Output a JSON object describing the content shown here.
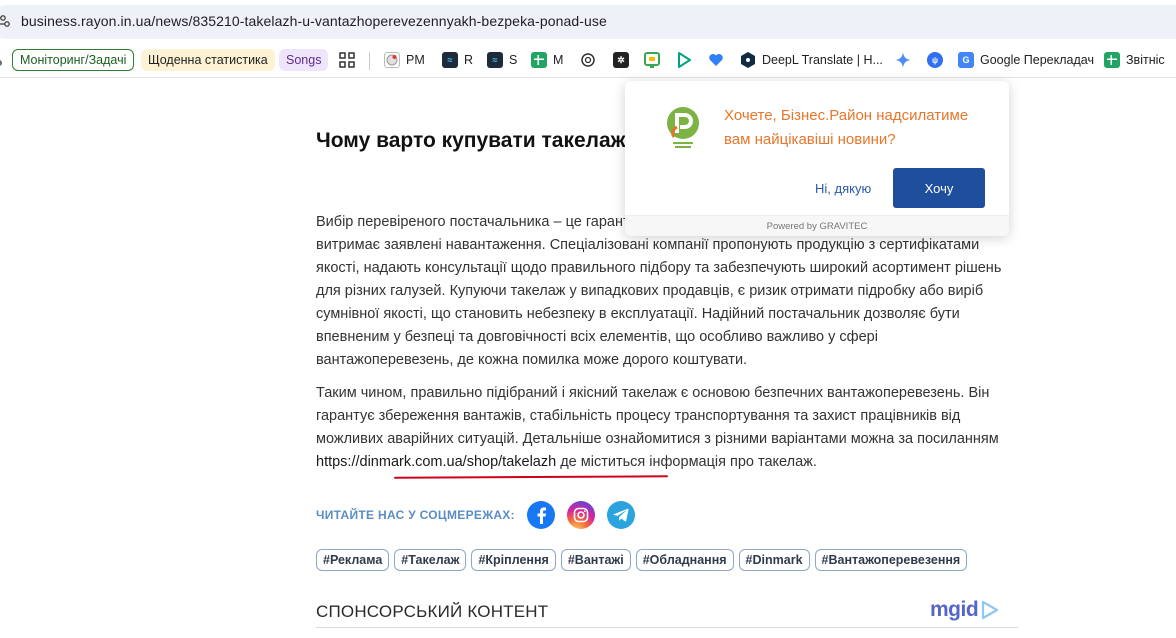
{
  "browser": {
    "url": "business.rayon.in.ua/news/835210-takelazh-u-vantazhoperevezennyakh-bezpeka-ponad-use",
    "bookmarks": [
      {
        "label": "Моніторинг/Задачі",
        "style": "chip-green"
      },
      {
        "label": "Щоденна статистика",
        "style": "chip-yellow"
      },
      {
        "label": "Songs",
        "style": "chip-purple"
      },
      {
        "label": "",
        "icon": "apps-grid-icon"
      },
      {
        "label": "PM",
        "icon": "pm-icon"
      },
      {
        "label": "R",
        "icon": "r-icon"
      },
      {
        "label": "S",
        "icon": "s-icon"
      },
      {
        "label": "M",
        "icon": "sheets-icon"
      },
      {
        "label": "",
        "icon": "openai-icon"
      },
      {
        "label": "",
        "icon": "pattern-icon"
      },
      {
        "label": "",
        "icon": "green-square-icon"
      },
      {
        "label": "",
        "icon": "play-icon"
      },
      {
        "label": "",
        "icon": "heart-icon"
      },
      {
        "label": "DeepL Translate | H...",
        "icon": "deepl-icon"
      },
      {
        "label": "",
        "icon": "gemini-icon"
      },
      {
        "label": "",
        "icon": "blue-circle-icon"
      },
      {
        "label": "Google Перекладач",
        "icon": "google-translate-icon"
      },
      {
        "label": "Звітніс",
        "icon": "sheets-icon"
      }
    ]
  },
  "article": {
    "heading": "Чому варто купувати такелаж у перевірених постачальників",
    "paragraph1": "Вибір перевіреного постачальника – це гарантія якості, безпеки та впевненості, що обладнання витримає заявлені навантаження. Спеціалізовані компанії пропонують продукцію з сертифікатами якості, надають консультації щодо правильного підбору та забезпечують широкий асортимент рішень для різних галузей. Купуючи такелаж у випадкових продавців, є ризик отримати підробку або виріб сумнівної якості, що становить небезпеку в експлуатації. Надійний постачальник дозволяє бути впевненим у безпеці та довговічності всіх елементів, що особливо важливо у сфері вантажоперевезень, де кожна помилка може дорого коштувати.",
    "paragraph2_before": "Таким чином, правильно підібраний і якісний такелаж є основою безпечних вантажоперевезень. Він гарантує збереження вантажів, стабільність процесу транспортування та захист працівників від можливих аварійних ситуацій. Детальніше ознайомитися з різними варіантами можна за посиланням ",
    "paragraph2_link": "https://dinmark.com.ua/shop/takelazh",
    "paragraph2_after": " де міститься інформація про такелаж.",
    "social_label": "ЧИТАЙТЕ НАС У СОЦМЕРЕЖАХ:",
    "tags": [
      "#Реклама",
      "#Такелаж",
      "#Кріплення",
      "#Вантажі",
      "#Обладнання",
      "#Dinmark",
      "#Вантажоперевезення"
    ],
    "sponsored_title": "СПОНСОРСЬКИЙ КОНТЕНТ",
    "sponsor_logo": "mgid"
  },
  "popup": {
    "message": "Хочете, Бізнес.Район надсилатиме вам найцікавіші новини?",
    "decline_label": "Ні, дякую",
    "accept_label": "Хочу",
    "footer": "Powered by GRAVITEC"
  },
  "colors": {
    "accent_blue": "#1f4f9c",
    "popup_text": "#e8762a",
    "underline_red": "#d0021b",
    "social_label": "#5a8dc4"
  }
}
